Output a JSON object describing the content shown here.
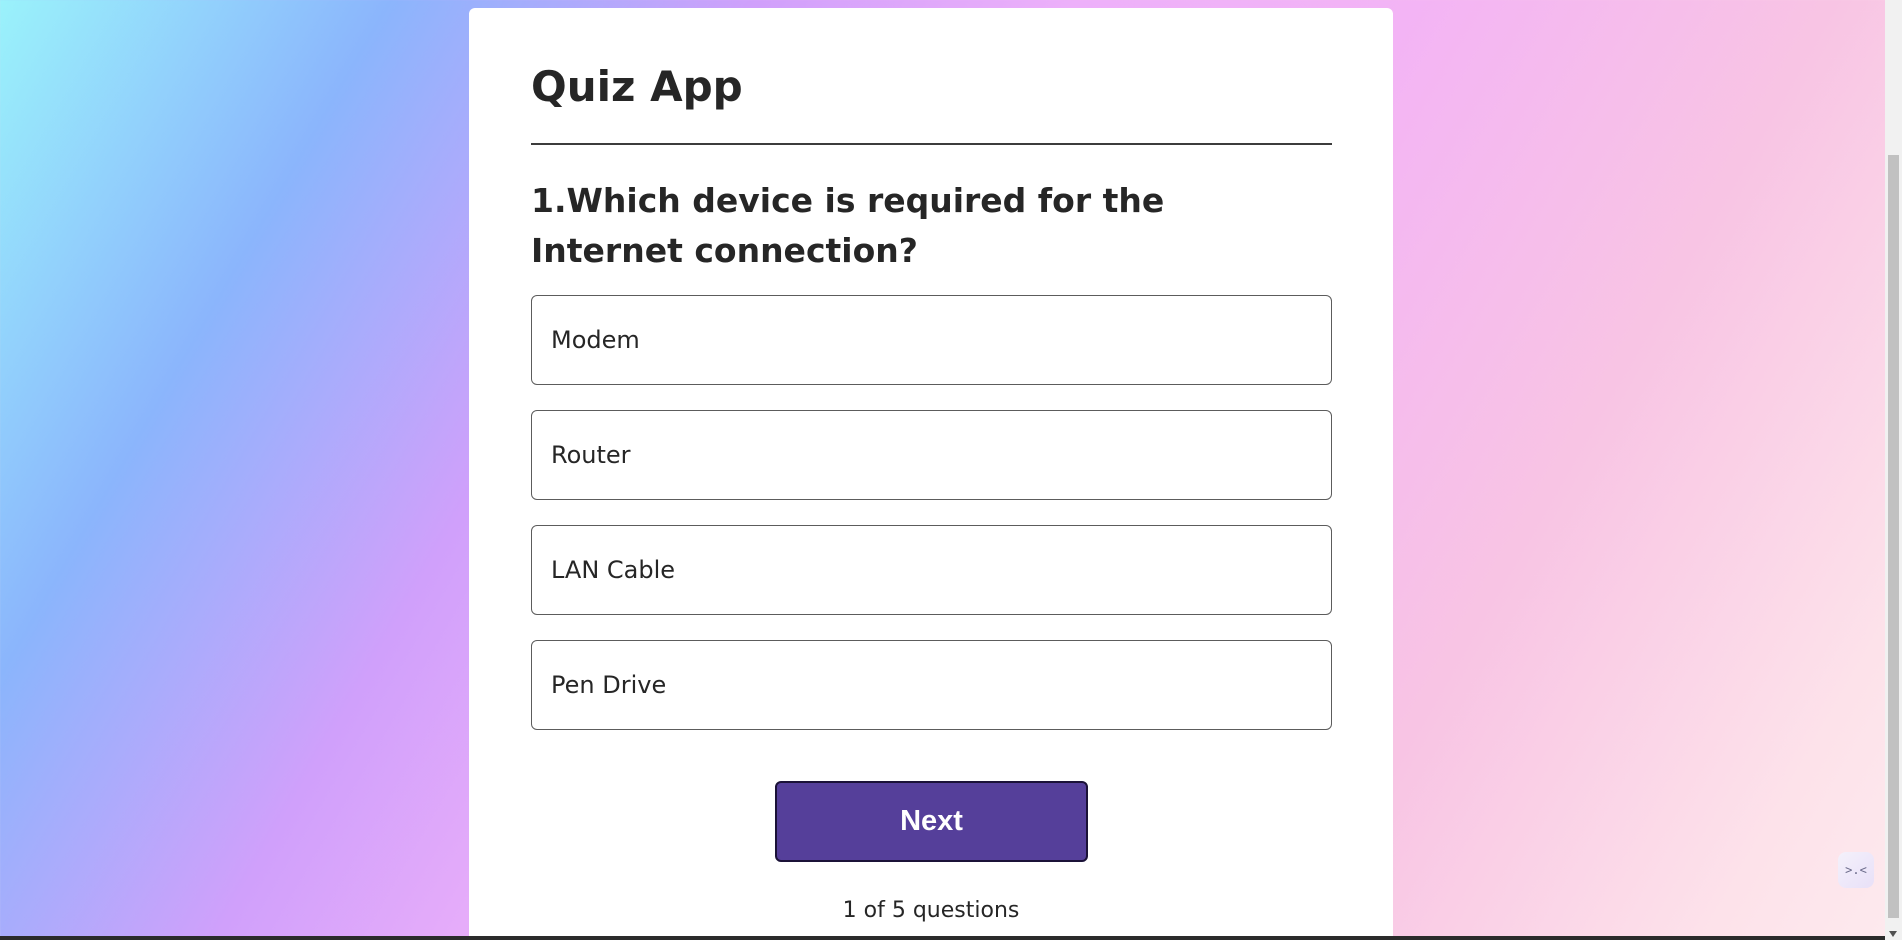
{
  "app": {
    "title": "Quiz App"
  },
  "question": {
    "text": "1.Which device is required for the Internet connection?"
  },
  "options": [
    {
      "label": "Modem"
    },
    {
      "label": "Router"
    },
    {
      "label": "LAN Cable"
    },
    {
      "label": "Pen Drive"
    }
  ],
  "controls": {
    "next_label": "Next"
  },
  "progress": {
    "text": "1 of 5 questions"
  },
  "extension": {
    "icon_glyph": ">.<"
  },
  "colors": {
    "next_button_bg": "#553f9a",
    "card_bg": "#ffffff",
    "text": "#262626"
  }
}
